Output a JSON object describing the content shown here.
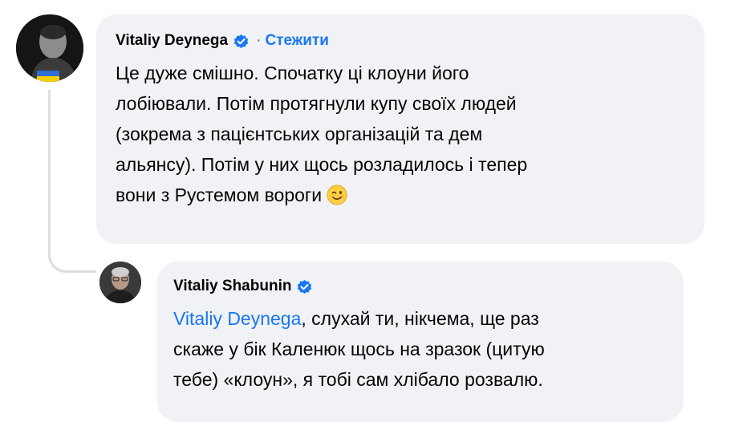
{
  "comments": [
    {
      "author": "Vitaliy Deynega",
      "verified": true,
      "separator": "·",
      "follow_label": "Стежити",
      "lines": [
        "Це дуже смішно. Спочатку ці клоуни його",
        "лобіювали. Потім протягнули купу своїх людей",
        "(зокрема з пацієнтських організацій та дем",
        "альянсу). Потім у них щось розладилось і тепер",
        "вони з Рустемом вороги"
      ],
      "emoji": "wink-emoji"
    },
    {
      "author": "Vitaliy Shabunin",
      "verified": true,
      "mention": "Vitaliy Deynega",
      "line1_rest": ", слухай ти, нікчема, ще раз",
      "lines": [
        "скаже у бік Каленюк щось на зразок (цитую",
        "тебе) «клоун», я тобі сам хлібало розвалю."
      ]
    }
  ],
  "colors": {
    "bubble_bg": "#f0f2f5",
    "link": "#1877f2",
    "text": "#050505",
    "verified": "#1877f2",
    "thread_line": "#dadde1"
  },
  "icons": {
    "verified": "verified-badge-icon",
    "wink": "wink-emoji-icon"
  }
}
